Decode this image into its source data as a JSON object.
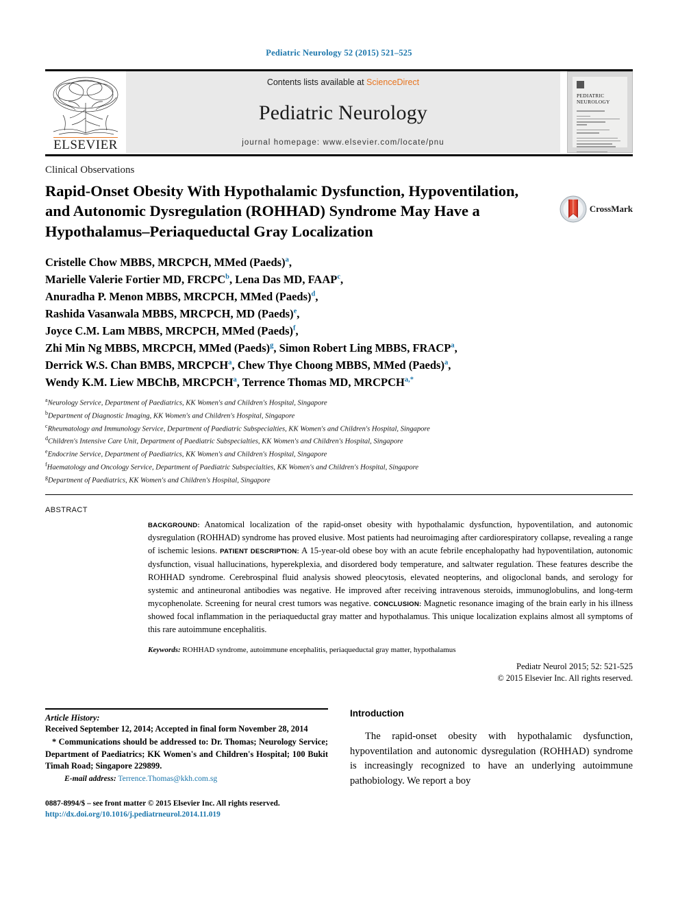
{
  "running_head": "Pediatric Neurology 52 (2015) 521–525",
  "masthead": {
    "contents_prefix": "Contents lists available at ",
    "sciencedirect": "ScienceDirect",
    "journal_name": "Pediatric Neurology",
    "homepage": "journal homepage: www.elsevier.com/locate/pnu",
    "publisher": "ELSEVIER",
    "cover_title": "PEDIATRIC NEUROLOGY",
    "accent_orange": "#e87722",
    "accent_blue": "#1a75ab"
  },
  "article": {
    "section_label": "Clinical Observations",
    "title": "Rapid-Onset Obesity With Hypothalamic Dysfunction, Hypoventilation, and Autonomic Dysregulation (ROHHAD) Syndrome May Have a Hypothalamus–Periaqueductal Gray Localization",
    "crossmark_label": "CrossMark"
  },
  "authors": [
    {
      "text": "Cristelle Chow MBBS, MRCPCH, MMed (Paeds)",
      "sup": "a",
      "tail": ","
    },
    {
      "text": "Marielle Valerie Fortier MD, FRCPC",
      "sup": "b",
      "tail": ", Lena Das MD, FAAP",
      "sup2": "c",
      "tail2": ","
    },
    {
      "text": "Anuradha P. Menon MBBS, MRCPCH, MMed (Paeds)",
      "sup": "d",
      "tail": ","
    },
    {
      "text": "Rashida Vasanwala MBBS, MRCPCH, MD (Paeds)",
      "sup": "e",
      "tail": ","
    },
    {
      "text": "Joyce C.M. Lam MBBS, MRCPCH, MMed (Paeds)",
      "sup": "f",
      "tail": ","
    },
    {
      "text": "Zhi Min Ng MBBS, MRCPCH, MMed (Paeds)",
      "sup": "g",
      "tail": ", Simon Robert Ling MBBS, FRACP",
      "sup2": "a",
      "tail2": ","
    },
    {
      "text": "Derrick W.S. Chan BMBS, MRCPCH",
      "sup": "a",
      "tail": ", Chew Thye Choong MBBS, MMed (Paeds)",
      "sup2": "a",
      "tail2": ","
    },
    {
      "text": "Wendy K.M. Liew MBChB, MRCPCH",
      "sup": "a",
      "tail": ", Terrence Thomas MD, MRCPCH",
      "sup2": "a,*",
      "tail2": ""
    }
  ],
  "affiliations": [
    {
      "marker": "a",
      "text": "Neurology Service, Department of Paediatrics, KK Women's and Children's Hospital, Singapore"
    },
    {
      "marker": "b",
      "text": "Department of Diagnostic Imaging, KK Women's and Children's Hospital, Singapore"
    },
    {
      "marker": "c",
      "text": "Rheumatology and Immunology Service, Department of Paediatric Subspecialties, KK Women's and Children's Hospital, Singapore"
    },
    {
      "marker": "d",
      "text": "Children's Intensive Care Unit, Department of Paediatric Subspecialties, KK Women's and Children's Hospital, Singapore"
    },
    {
      "marker": "e",
      "text": "Endocrine Service, Department of Paediatrics, KK Women's and Children's Hospital, Singapore"
    },
    {
      "marker": "f",
      "text": "Haematology and Oncology Service, Department of Paediatric Subspecialties, KK Women's and Children's Hospital, Singapore"
    },
    {
      "marker": "g",
      "text": "Department of Paediatrics, KK Women's and Children's Hospital, Singapore"
    }
  ],
  "abstract": {
    "label": "ABSTRACT",
    "segments": [
      {
        "runin": "BACKGROUND:",
        "text": " Anatomical localization of the rapid-onset obesity with hypothalamic dysfunction, hypoventilation, and autonomic dysregulation (ROHHAD) syndrome has proved elusive. Most patients had neuroimaging after cardiorespiratory collapse, revealing a range of ischemic lesions. "
      },
      {
        "runin": "PATIENT DESCRIPTION:",
        "text": " A 15-year-old obese boy with an acute febrile encephalopathy had hypoventilation, autonomic dysfunction, visual hallucinations, hyperekplexia, and disordered body temperature, and saltwater regulation. These features describe the ROHHAD syndrome. Cerebrospinal fluid analysis showed pleocytosis, elevated neopterins, and oligoclonal bands, and serology for systemic and antineuronal antibodies was negative. He improved after receiving intravenous steroids, immunoglobulins, and long-term mycophenolate. Screening for neural crest tumors was negative. "
      },
      {
        "runin": "CONCLUSION:",
        "text": " Magnetic resonance imaging of the brain early in his illness showed focal inflammation in the periaqueductal gray matter and hypothalamus. This unique localization explains almost all symptoms of this rare autoimmune encephalitis."
      }
    ],
    "keywords_label": "Keywords:",
    "keywords_text": " ROHHAD syndrome, autoimmune encephalitis, periaqueductal gray matter, hypothalamus",
    "citation": "Pediatr Neurol 2015; 52: 521-525",
    "copyright": "© 2015 Elsevier Inc. All rights reserved."
  },
  "footer": {
    "history_head": "Article History:",
    "history_text": "Received September 12, 2014; Accepted in final form November 28, 2014",
    "correspondence": "* Communications should be addressed to: Dr. Thomas; Neurology Service; Department of Paediatrics; KK Women's and Children's Hospital; 100 Bukit Timah Road; Singapore 229899.",
    "email_label": "E-mail address:",
    "email": "Terrence.Thomas@kkh.com.sg",
    "issn": "0887-8994/$ – see front matter © 2015 Elsevier Inc. All rights reserved.",
    "doi": "http://dx.doi.org/10.1016/j.pediatrneurol.2014.11.019"
  },
  "introduction": {
    "heading": "Introduction",
    "paragraph": "The rapid-onset obesity with hypothalamic dysfunction, hypoventilation and autonomic dysregulation (ROHHAD) syndrome is increasingly recognized to have an underlying autoimmune pathobiology. We report a boy"
  }
}
